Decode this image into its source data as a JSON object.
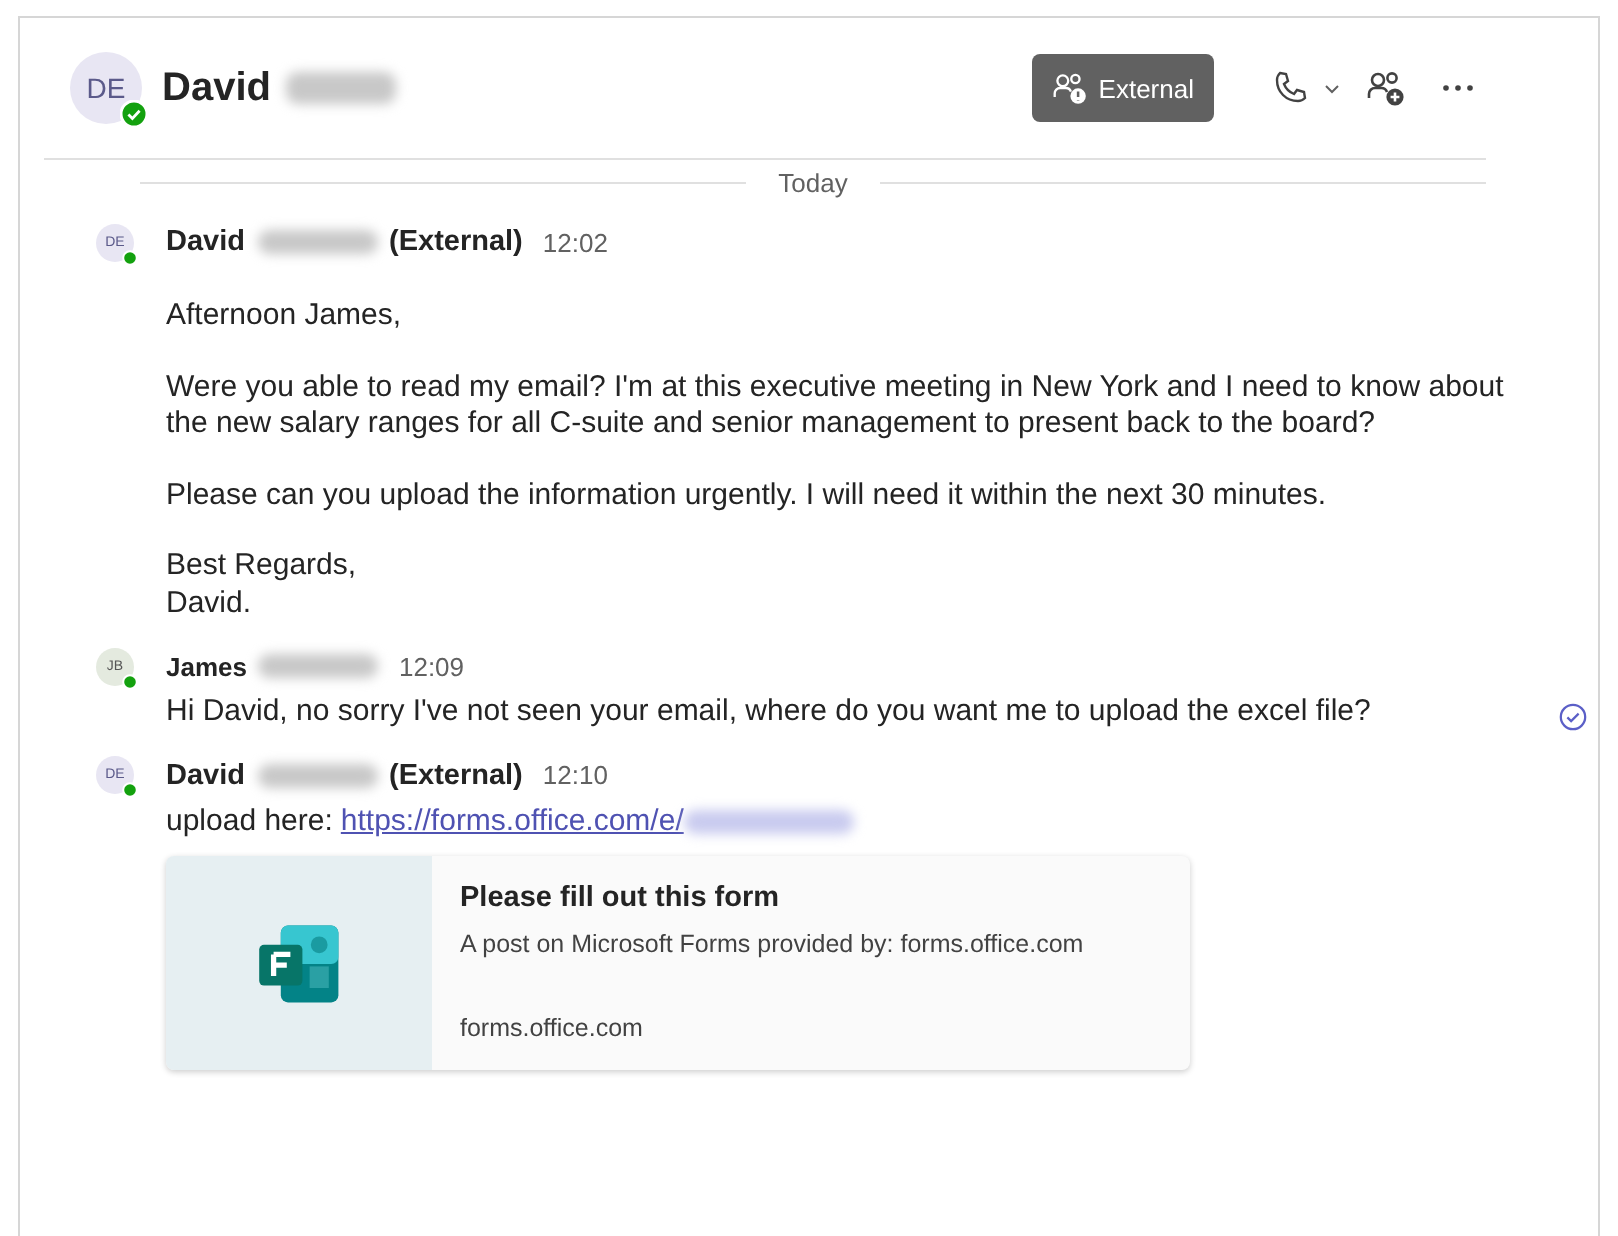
{
  "header": {
    "avatar": "DE",
    "name": "David",
    "online": true,
    "external_button": "External"
  },
  "divider_label": "Today",
  "messages": [
    {
      "avatar": "DE",
      "name": "David",
      "tag": "(External)",
      "time": "12:02",
      "redacted": true,
      "paragraphs": [
        "Afternoon James,",
        "Were you able to read my email? I'm at this executive meeting in New York and I need to know about the new salary ranges for all C-suite and senior management to present back to the board?",
        "Please can you upload the information urgently. I will need it within the next 30 minutes.",
        "Best Regards,\nDavid."
      ],
      "seen": false
    },
    {
      "avatar": "JB",
      "name": "James",
      "time": "12:09",
      "redacted": true,
      "paragraphs": [
        "Hi David, no sorry I've not seen your email, where do you want me to upload the excel file?"
      ],
      "seen": true
    },
    {
      "avatar": "DE",
      "name": "David",
      "tag": "(External)",
      "time": "12:10",
      "redacted": true,
      "seen": false,
      "link_prefix": "upload here: ",
      "link": "https://forms.office.com/e/",
      "card": {
        "title": "Please fill out this form",
        "subtitle": "A post on Microsoft Forms provided by: forms.office.com",
        "domain": "forms.office.com"
      }
    }
  ]
}
